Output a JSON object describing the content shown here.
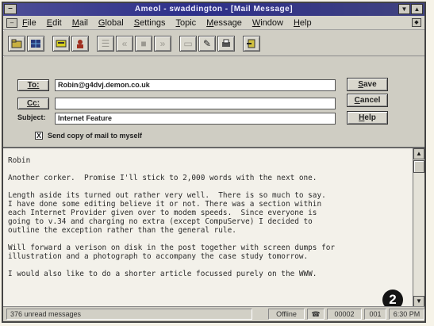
{
  "window": {
    "title": "Ameol - swaddington - [Mail Message]"
  },
  "menu": [
    "File",
    "Edit",
    "Mail",
    "Global",
    "Settings",
    "Topic",
    "Message",
    "Window",
    "Help"
  ],
  "toolbar": {
    "icons": [
      "folder-icon",
      "grid-icon",
      "print-icon",
      "person-icon",
      "list-icon",
      "back-icon",
      "stop-icon",
      "forward-icon",
      "disabled-icon",
      "stamp-icon",
      "printer-icon",
      "exit-icon"
    ]
  },
  "compose": {
    "to_label": "To:",
    "to_value": "Robin@g4dvj.demon.co.uk",
    "cc_label": "Cc:",
    "cc_value": "",
    "subject_label": "Subject:",
    "subject_value": "Internet Feature",
    "copy_checked": "X",
    "copy_label": "Send copy of mail to myself",
    "save_label": "Save",
    "cancel_label": "Cancel",
    "help_label": "Help"
  },
  "body": {
    "paragraphs": [
      "Robin",
      "Another corker.  Promise I'll stick to 2,000 words with the next one.",
      "Length aside its turned out rather very well.  There is so much to say.\nI have done some editing believe it or not. There was a section within\neach Internet Provider given over to modem speeds.  Since everyone is\ngoing to v.34 and charging no extra (except CompuServe) I decided to\noutline the exception rather than the general rule.",
      "Will forward a verison on disk in the post together with screen dumps for\nillustration and a photograph to accompany the case study tomorrow.",
      "I would also like to do a shorter article focussed purely on the WWW."
    ]
  },
  "callout_number": "2",
  "status": {
    "unread": "376 unread messages",
    "mode": "Offline",
    "count1": "00002",
    "count2": "001",
    "time": "6:30 PM"
  }
}
